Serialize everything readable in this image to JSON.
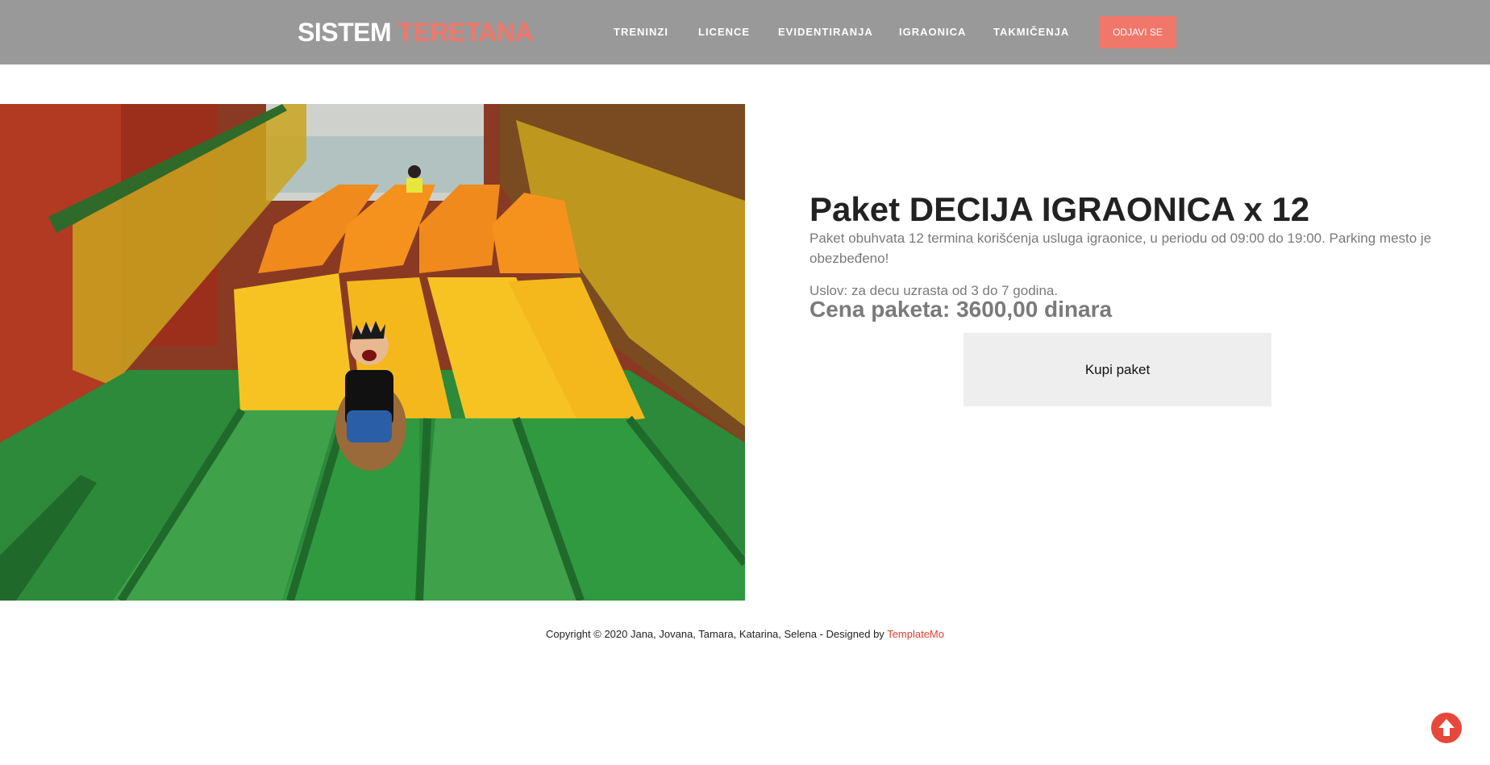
{
  "brand": {
    "part1": "SISTEM",
    "part2": "TERETANA"
  },
  "nav": {
    "items": [
      {
        "label": "TRENINZI"
      },
      {
        "label": "LICENCE"
      },
      {
        "label": "EVIDENTIRANJA"
      },
      {
        "label": "IGRAONICA"
      },
      {
        "label": "TAKMIČENJA"
      }
    ],
    "logout_label": "ODJAVI SE"
  },
  "package": {
    "title": "Paket DECIJA IGRAONICA x 12",
    "description": "Paket obuhvata 12 termina korišćenja usluga igraonice, u periodu od 09:00 do 19:00. Parking mesto je obezbeđeno!",
    "condition": "Uslov: za decu uzrasta od 3 do 7 godina.",
    "price": "Cena paketa: 3600,00 dinara",
    "buy_label": "Kupi paket"
  },
  "footer": {
    "copyright": "Copyright © 2020 Jana, Jovana, Tamara, Katarina, Selena - Designed by ",
    "designer_link": "TemplateMo"
  },
  "icons": {
    "photo": "child-on-playground-slide-photo",
    "scroll_top": "arrow-up-circle-icon"
  },
  "colors": {
    "header_bg": "#999999",
    "accent": "#f0776a",
    "link": "#e0412f"
  }
}
